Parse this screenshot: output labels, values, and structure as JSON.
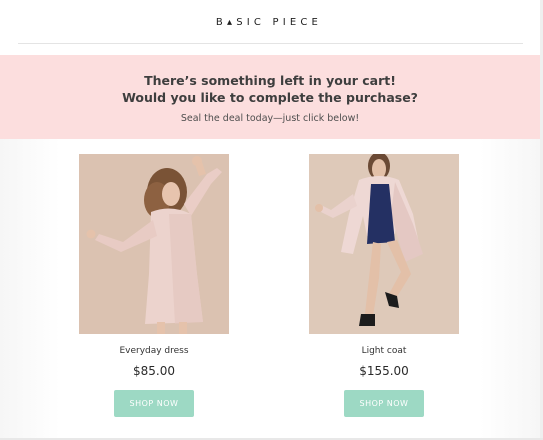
{
  "brand": {
    "name": "B▴SIC PIECE"
  },
  "banner": {
    "line1": "There’s something left in your cart!",
    "line2": "Would you like to complete the purchase?",
    "subtitle": "Seal the deal today—just click below!"
  },
  "products": [
    {
      "name": "Everyday dress",
      "price": "$85.00",
      "button_label": "SHOP NOW",
      "photo": "woman-in-pink-dress"
    },
    {
      "name": "Light coat",
      "price": "$155.00",
      "button_label": "SHOP NOW",
      "photo": "woman-in-light-coat"
    }
  ],
  "colors": {
    "banner_bg": "#fcdede",
    "button_bg": "#9dd9c4",
    "photo_bg": "#d9bfae"
  }
}
